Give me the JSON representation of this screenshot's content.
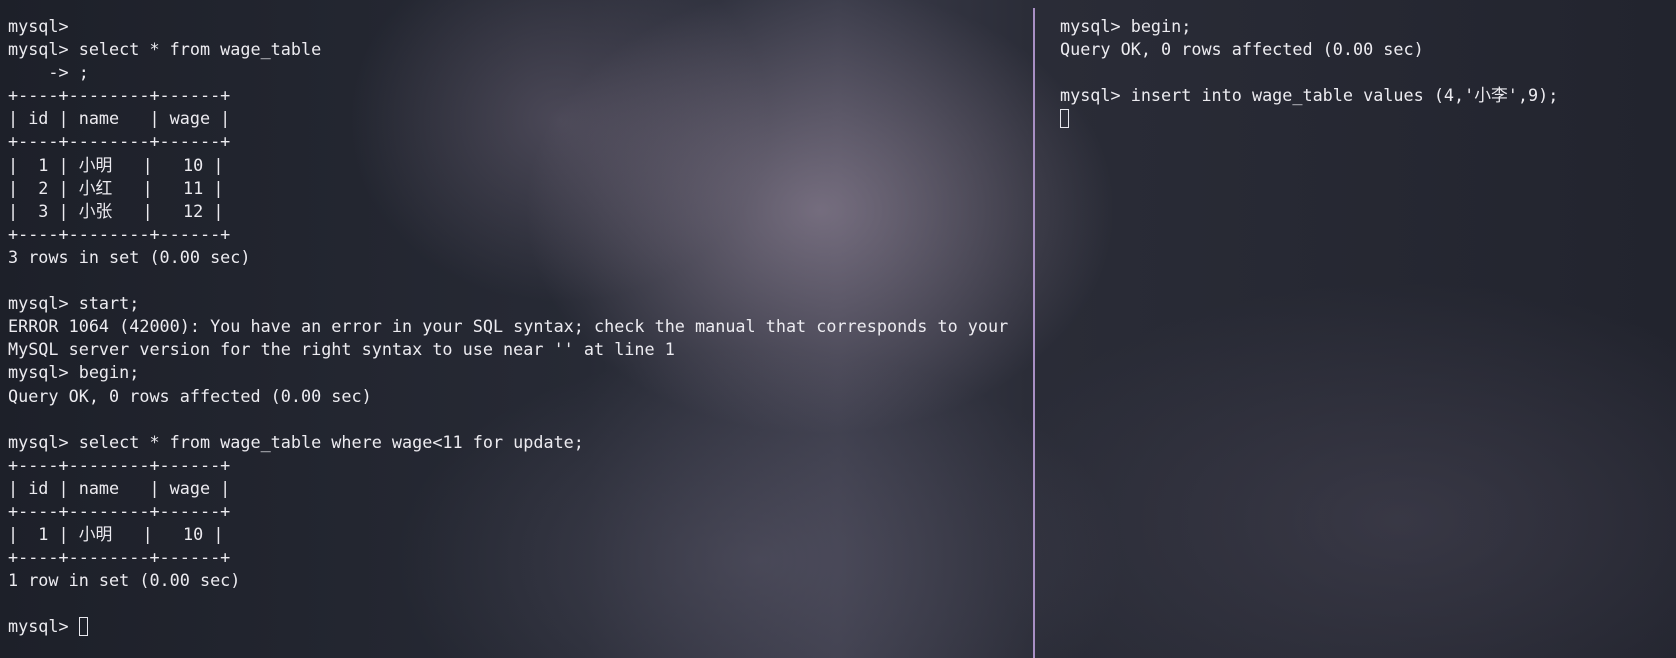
{
  "left_pane": {
    "lines": [
      "mysql>",
      "mysql> select * from wage_table",
      "    -> ;",
      "+----+--------+------+",
      "| id | name   | wage |",
      "+----+--------+------+",
      "|  1 | 小明   |   10 |",
      "|  2 | 小红   |   11 |",
      "|  3 | 小张   |   12 |",
      "+----+--------+------+",
      "3 rows in set (0.00 sec)",
      "",
      "mysql> start;",
      "ERROR 1064 (42000): You have an error in your SQL syntax; check the manual that corresponds to your",
      "MySQL server version for the right syntax to use near '' at line 1",
      "mysql> begin;",
      "Query OK, 0 rows affected (0.00 sec)",
      "",
      "mysql> select * from wage_table where wage<11 for update;",
      "+----+--------+------+",
      "| id | name   | wage |",
      "+----+--------+------+",
      "|  1 | 小明   |   10 |",
      "+----+--------+------+",
      "1 row in set (0.00 sec)",
      ""
    ],
    "prompt": "mysql> "
  },
  "right_pane": {
    "lines": [
      "mysql> begin;",
      "Query OK, 0 rows affected (0.00 sec)",
      "",
      "mysql> insert into wage_table values (4,'小李',9);"
    ]
  },
  "colors": {
    "divider": "#a88fc4",
    "text": "#ecebf0"
  }
}
